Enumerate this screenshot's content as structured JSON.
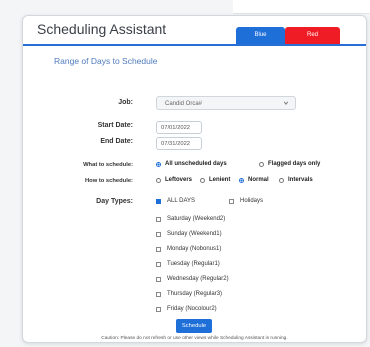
{
  "window": {
    "title": "Scheduling Assistant",
    "tabs": [
      {
        "label": "Blue"
      },
      {
        "label": "Red"
      }
    ]
  },
  "form": {
    "section_title": "Range of Days to Schedule",
    "job_label": "Job:",
    "job_value": "Candid Orca#",
    "start_label": "Start Date:",
    "start_value": "07/01/2022",
    "end_label": "End Date:",
    "end_value": "07/31/2022",
    "what_label": "What to schedule:",
    "what_options": [
      {
        "label": "All unscheduled days",
        "selected": true
      },
      {
        "label": "Flagged days only",
        "selected": false
      }
    ],
    "how_label": "How to schedule:",
    "how_options": [
      {
        "label": "Leftovers",
        "selected": false
      },
      {
        "label": "Lenient",
        "selected": false
      },
      {
        "label": "Normal",
        "selected": true
      },
      {
        "label": "Intervals",
        "selected": false
      }
    ],
    "daytypes_label": "Day Types:",
    "all_days_label": "ALL DAYS",
    "holidays_label": "Holidays",
    "day_types": [
      "Saturday (Weekend2)",
      "Sunday (Weekend1)",
      "Monday (Nobonus1)",
      "Tuesday (Regular1)",
      "Wednesday (Regular2)",
      "Thursday (Regular3)",
      "Friday (Nocolour2)"
    ],
    "schedule_button": "Schedule"
  },
  "footer": "Caution: Please do not refresh or use other views while Scheduling Assistant is running.",
  "colors": {
    "accent": "#1f6fd9",
    "red_tab": "#ef1c25",
    "section_title": "#4f7bbd"
  }
}
